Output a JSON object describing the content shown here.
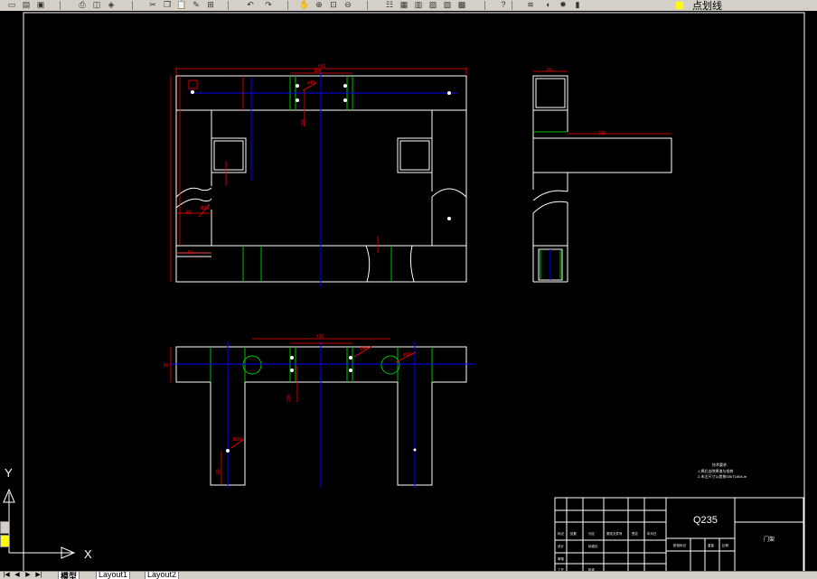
{
  "toolbar": {
    "buttons": [
      {
        "name": "new-icon",
        "glyph": "▭"
      },
      {
        "name": "open-icon",
        "glyph": "▤"
      },
      {
        "name": "save-icon",
        "glyph": "▣"
      },
      {
        "name": "plot-icon",
        "glyph": "⎙"
      },
      {
        "name": "preview-icon",
        "glyph": "◫"
      },
      {
        "name": "publish-icon",
        "glyph": "◈"
      },
      {
        "name": "cut-icon",
        "glyph": "✂"
      },
      {
        "name": "copy-icon",
        "glyph": "❐"
      },
      {
        "name": "paste-icon",
        "glyph": "📋"
      },
      {
        "name": "match-properties-icon",
        "glyph": "✎"
      },
      {
        "name": "block-editor-icon",
        "glyph": "⊞"
      },
      {
        "name": "undo-icon",
        "glyph": "↶"
      },
      {
        "name": "redo-icon",
        "glyph": "↷"
      },
      {
        "name": "pan-icon",
        "glyph": "✋"
      },
      {
        "name": "zoom-realtime-icon",
        "glyph": "⊕"
      },
      {
        "name": "zoom-window-icon",
        "glyph": "⊡"
      },
      {
        "name": "zoom-previous-icon",
        "glyph": "⊖"
      },
      {
        "name": "properties-icon",
        "glyph": "☷"
      },
      {
        "name": "design-center-icon",
        "glyph": "▦"
      },
      {
        "name": "tool-palettes-icon",
        "glyph": "▥"
      },
      {
        "name": "sheet-set-icon",
        "glyph": "▨"
      },
      {
        "name": "markup-icon",
        "glyph": "▧"
      },
      {
        "name": "quickcalc-icon",
        "glyph": "▩"
      },
      {
        "name": "help-icon",
        "glyph": "?"
      },
      {
        "name": "layer-manager-icon",
        "glyph": "≋"
      },
      {
        "name": "layer-state-icon",
        "glyph": "◐"
      },
      {
        "name": "freeze-icon",
        "glyph": "✹"
      },
      {
        "name": "lock-icon",
        "glyph": "▮"
      }
    ],
    "layer": "点划线",
    "colors": {
      "bg": "#d4d0c8",
      "layer_swatch": "#ffff00"
    }
  },
  "drawing": {
    "colors": {
      "outline": "#ffffff",
      "dimension": "#ff0000",
      "centerline": "#0000ff",
      "green": "#00c000"
    },
    "front_dims": {
      "overall": "450",
      "top_span": "100",
      "hole": "φ10",
      "vertical": "200",
      "left_small": "50",
      "left_mid": "80",
      "radius": "R20"
    },
    "side_dims": {
      "top": "80",
      "arm": "300"
    },
    "plan_dims": {
      "span": "410",
      "hole1": "φ20",
      "hole2": "φ30",
      "vertical": "200",
      "height": "80",
      "radius": "R10",
      "bottom": "90"
    },
    "note_lines": [
      "技术要求",
      "1.焊后去除焊渣与毛刺",
      "2.未注尺寸公差按GB/T1804-m"
    ]
  },
  "title_block": {
    "material": "Q235",
    "part_name": "门架",
    "cells": [
      "标记",
      "处数",
      "分区",
      "更改文件号",
      "签名",
      "年月日",
      "设计",
      "标准化",
      "阶段标记",
      "重量",
      "比例",
      "审核",
      "工艺",
      "批准"
    ]
  },
  "ucs": {
    "x_label": "X",
    "y_label": "Y"
  },
  "tabs": {
    "model": "模型",
    "layout1": "Layout1",
    "layout2": "Layout2"
  }
}
